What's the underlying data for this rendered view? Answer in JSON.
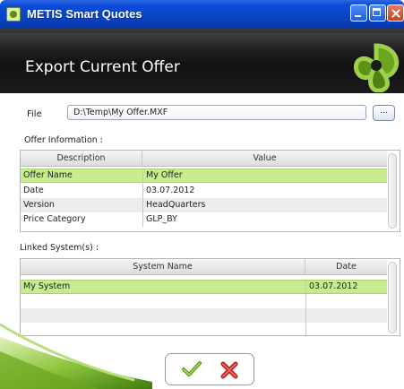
{
  "window": {
    "title": "METIS Smart Quotes"
  },
  "header": {
    "title": "Export Current Offer"
  },
  "file": {
    "label": "File",
    "value": "D:\\Temp\\My Offer.MXF",
    "browse_label": "..."
  },
  "offer_info": {
    "label": "Offer Information :",
    "columns": [
      "Description",
      "Value"
    ],
    "rows": [
      {
        "description": "Offer Name",
        "value": "My Offer",
        "selected": true
      },
      {
        "description": "Date",
        "value": "03.07.2012"
      },
      {
        "description": "Version",
        "value": "HeadQuarters"
      },
      {
        "description": "Price Category",
        "value": "GLP_BY"
      }
    ]
  },
  "linked_systems": {
    "label": "Linked System(s) :",
    "columns": [
      "System Name",
      "Date"
    ],
    "rows": [
      {
        "name": "My System",
        "date": "03.07.2012",
        "selected": true
      },
      {
        "name": "",
        "date": ""
      },
      {
        "name": "",
        "date": ""
      },
      {
        "name": "",
        "date": ""
      }
    ]
  },
  "actions": {
    "ok_icon": "checkmark-icon",
    "cancel_icon": "x-icon"
  },
  "colors": {
    "selection": "#c7ec8f",
    "accent": "#6aa51c",
    "titlebar": "#0b4bd8",
    "cancel": "#d93030"
  }
}
